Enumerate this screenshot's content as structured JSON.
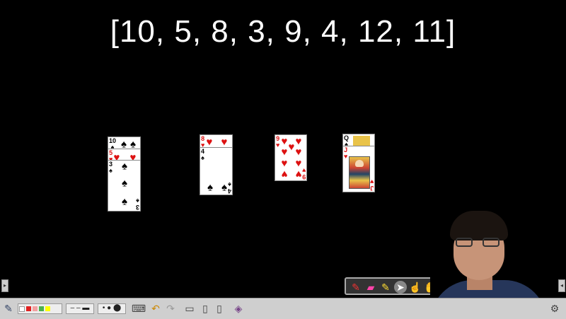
{
  "title": "[10, 5, 8, 3, 9, 4, 12, 11]",
  "cards": [
    {
      "rank": "10",
      "suit": "♠",
      "color": "black"
    },
    {
      "rank": "5",
      "suit": "♥",
      "color": "red"
    },
    {
      "rank": "3",
      "suit": "♠",
      "color": "black"
    },
    {
      "rank": "8",
      "suit": "♥",
      "color": "red"
    },
    {
      "rank": "4",
      "suit": "♠",
      "color": "black"
    },
    {
      "rank": "9",
      "suit": "♥",
      "color": "red"
    },
    {
      "rank": "Q",
      "suit": "♠",
      "color": "black"
    },
    {
      "rank": "J",
      "suit": "♥",
      "color": "red"
    }
  ],
  "toolbar": {
    "pen_colors": [
      "#ffffff",
      "#e02020",
      "#f2a0a0",
      "#4caf50",
      "#ffff00"
    ],
    "icons": [
      "pen-tool-icon",
      "line-style-icon",
      "dot-size-icon",
      "keyboard-icon",
      "undo-icon",
      "redo-icon",
      "screen-icon",
      "page-icon",
      "page-copy-icon",
      "shape-icon",
      "settings-icon"
    ]
  },
  "floating_toolbar": {
    "icons": [
      "marker-icon",
      "eraser-icon",
      "highlighter-icon",
      "cursor-icon",
      "pointer-hand-icon",
      "grab-hand-icon"
    ]
  },
  "side_tabs": {
    "left": "▸",
    "right": "◂"
  }
}
